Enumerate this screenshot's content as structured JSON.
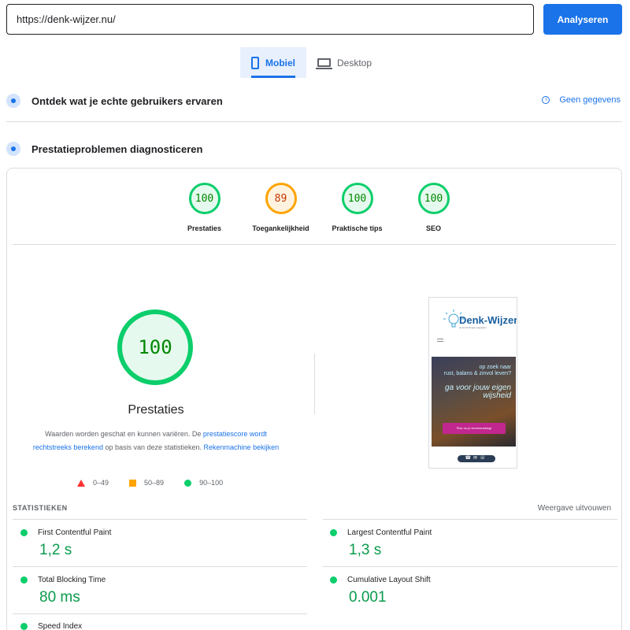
{
  "url_input": {
    "value": "https://denk-wijzer.nu/"
  },
  "analyze_button": "Analyseren",
  "device_tabs": {
    "mobile": "Mobiel",
    "desktop": "Desktop"
  },
  "field_data": {
    "title": "Ontdek wat je echte gebruikers ervaren",
    "no_data": "Geen gegevens"
  },
  "lab_data": {
    "title": "Prestatieproblemen diagnosticeren"
  },
  "categories": [
    {
      "score": "100",
      "label": "Prestaties"
    },
    {
      "score": "89",
      "label": "Toegankelijkheid"
    },
    {
      "score": "100",
      "label": "Praktische tips"
    },
    {
      "score": "100",
      "label": "SEO"
    }
  ],
  "performance": {
    "score": "100",
    "title": "Prestaties",
    "desc_1": "Waarden worden geschat en kunnen variëren. De ",
    "desc_link_1": "prestatiescore wordt rechtstreeks berekend",
    "desc_2": " op basis van deze statistieken. ",
    "desc_link_2": "Rekenmachine bekijken"
  },
  "legend": {
    "fail": "0–49",
    "average": "50–89",
    "pass": "90–100"
  },
  "thumbnail": {
    "brand": "Denk-Wijzer",
    "tagline": "de kunstzinnige wegwijzer",
    "hero_line1": "op zoek naar",
    "hero_line2": "rust, balans & zinvol leven?",
    "hero_line3": "ga voor jouw eigen",
    "hero_line4": "wijsheid",
    "hero_button": "Plan nu je kennismaking!"
  },
  "stats": {
    "heading": "STATISTIEKEN",
    "expand": "Weergave uitvouwen",
    "metrics": [
      {
        "label": "First Contentful Paint",
        "value": "1,2 s"
      },
      {
        "label": "Largest Contentful Paint",
        "value": "1,3 s"
      },
      {
        "label": "Total Blocking Time",
        "value": "80 ms"
      },
      {
        "label": "Cumulative Layout Shift",
        "value": "0.001"
      },
      {
        "label": "Speed Index",
        "value": ""
      }
    ]
  },
  "colors": {
    "accent": "#1a73e8",
    "pass": "#0cce6b",
    "average": "#ffa400",
    "fail": "#ff3333"
  }
}
